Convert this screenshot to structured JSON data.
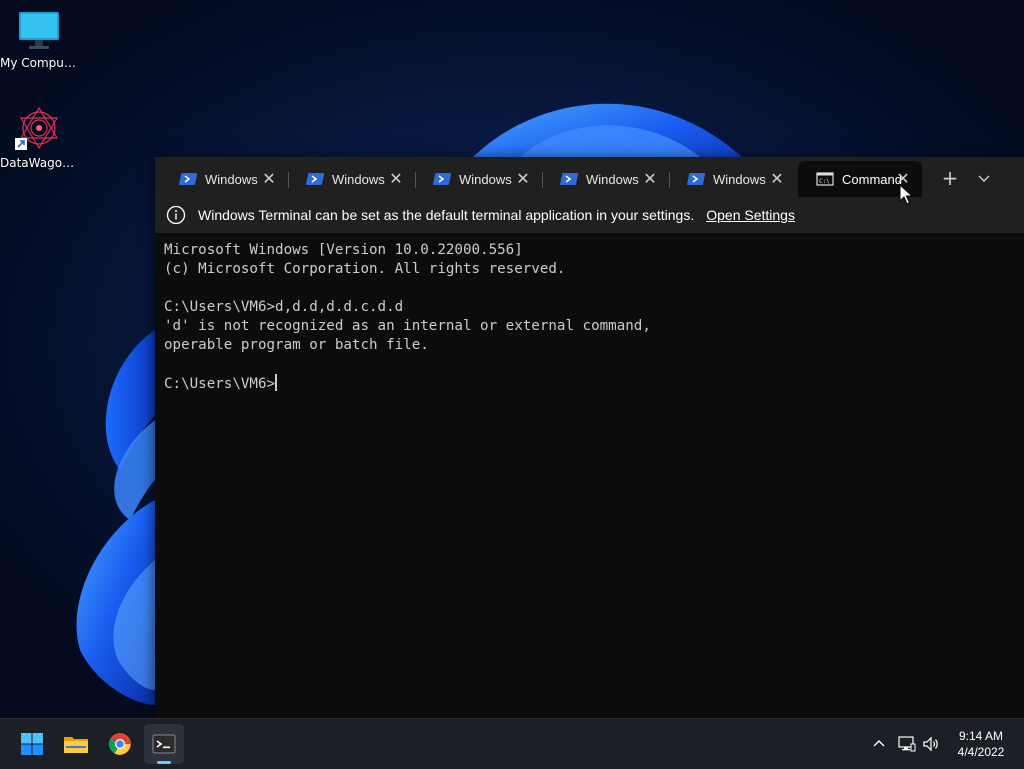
{
  "desktop": {
    "icons": [
      {
        "label": "My Computer",
        "icon": "monitor-icon"
      },
      {
        "label": "DataWagon...",
        "icon": "datawagon-app-icon"
      }
    ]
  },
  "terminal": {
    "tabs": [
      {
        "label": "Windows I",
        "icon": "powershell-icon"
      },
      {
        "label": "Windows I",
        "icon": "powershell-icon"
      },
      {
        "label": "Windows I",
        "icon": "powershell-icon"
      },
      {
        "label": "Windows I",
        "icon": "powershell-icon"
      },
      {
        "label": "Windows I",
        "icon": "powershell-icon"
      },
      {
        "label": "Command",
        "icon": "cmd-icon",
        "active": true
      }
    ],
    "close_glyph": "✕",
    "new_tab_glyph": "+",
    "infobar": {
      "message": "Windows Terminal can be set as the default terminal application in your settings.",
      "link": "Open Settings"
    },
    "console_lines": [
      "Microsoft Windows [Version 10.0.22000.556]",
      "(c) Microsoft Corporation. All rights reserved.",
      "",
      "C:\\Users\\VM6>d,d.d,d.d.c.d.d",
      "'d' is not recognized as an internal or external command,",
      "operable program or batch file.",
      "",
      "C:\\Users\\VM6>"
    ]
  },
  "taskbar": {
    "apps": [
      {
        "name": "start",
        "icon": "windows-start-icon"
      },
      {
        "name": "file-explorer",
        "icon": "folder-icon"
      },
      {
        "name": "chrome",
        "icon": "chrome-icon"
      },
      {
        "name": "terminal",
        "icon": "terminal-icon",
        "running": true
      }
    ],
    "clock": {
      "time": "9:14 AM",
      "date": "4/4/2022"
    }
  },
  "colors": {
    "accent": "#60cdff",
    "terminal_bg": "#0c0c0c",
    "tabbar_bg": "#202020",
    "taskbar_bg": "#1c1f26"
  }
}
